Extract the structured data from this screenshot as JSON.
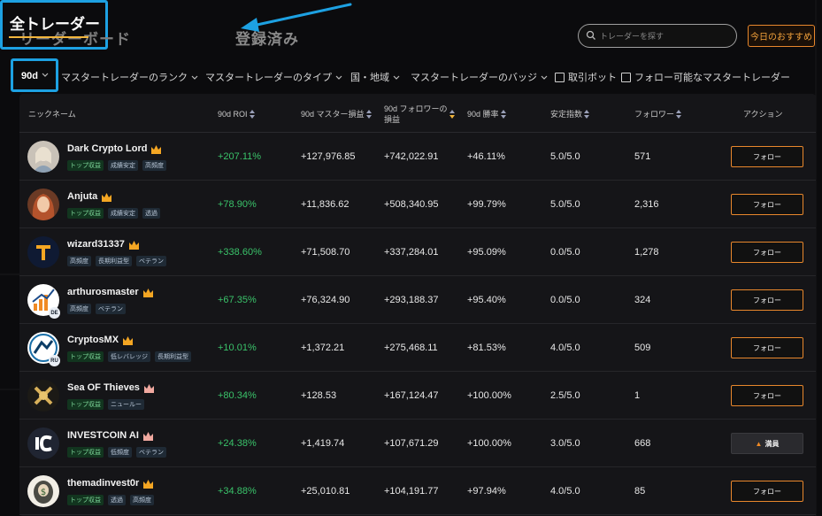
{
  "tabs": {
    "leaderboard": "リーダーボード",
    "all_traders": "全トレーダー",
    "registered": "登録済み"
  },
  "search": {
    "placeholder": "トレーダーを探す"
  },
  "today_recommend": "今日のおすすめ",
  "filters": {
    "period": "90d",
    "rank": "マスタートレーダーのランク",
    "type": "マスタートレーダーのタイプ",
    "region": "国・地域",
    "badge": "マスタートレーダーのバッジ",
    "trading_bot": "取引ボット",
    "followable": "フォロー可能なマスタートレーダー"
  },
  "table": {
    "headers": {
      "nickname": "ニックネーム",
      "roi": "90d ROI",
      "pnl": "90d マスター損益",
      "follower_pnl_1": "90d フォロワーの",
      "follower_pnl_2": "損益",
      "win_rate": "90d 勝率",
      "stability": "安定指数",
      "followers": "フォロワー",
      "action": "アクション"
    },
    "rows": [
      {
        "name": "Dark Crypto Lord",
        "tags": [
          "トップ収益",
          "成績安定",
          "高頻度"
        ],
        "roi": "+207.11%",
        "pnl": "+127,976.85",
        "follower_pnl": "+742,022.91",
        "win_rate": "+46.11%",
        "stability": "5.0/5.0",
        "followers": "571",
        "action": "フォロー"
      },
      {
        "name": "Anjuta",
        "tags": [
          "トップ収益",
          "成績安定",
          "透過"
        ],
        "roi": "+78.90%",
        "pnl": "+11,836.62",
        "follower_pnl": "+508,340.95",
        "win_rate": "+99.79%",
        "stability": "5.0/5.0",
        "followers": "2,316",
        "action": "フォロー"
      },
      {
        "name": "wizard31337",
        "tags": [
          "高頻度",
          "長期利益型",
          "ベテラン"
        ],
        "roi": "+338.60%",
        "pnl": "+71,508.70",
        "follower_pnl": "+337,284.01",
        "win_rate": "+95.09%",
        "stability": "0.0/5.0",
        "followers": "1,278",
        "action": "フォロー"
      },
      {
        "name": "arthurosmaster",
        "tags": [
          "高頻度",
          "ベテラン"
        ],
        "roi": "+67.35%",
        "pnl": "+76,324.90",
        "follower_pnl": "+293,188.37",
        "win_rate": "+95.40%",
        "stability": "0.0/5.0",
        "followers": "324",
        "action": "フォロー"
      },
      {
        "name": "CryptosMX",
        "tags": [
          "トップ収益",
          "低レバレッジ",
          "長期利益型"
        ],
        "roi": "+10.01%",
        "pnl": "+1,372.21",
        "follower_pnl": "+275,468.11",
        "win_rate": "+81.53%",
        "stability": "4.0/5.0",
        "followers": "509",
        "action": "フォロー"
      },
      {
        "name": "Sea OF Thieves",
        "tags": [
          "トップ収益",
          "ニュールー"
        ],
        "roi": "+80.34%",
        "pnl": "+128.53",
        "follower_pnl": "+167,124.47",
        "win_rate": "+100.00%",
        "stability": "2.5/5.0",
        "followers": "1",
        "action": "フォロー"
      },
      {
        "name": "INVESTCOIN AI",
        "tags": [
          "トップ収益",
          "低頻度",
          "ベテラン"
        ],
        "roi": "+24.38%",
        "pnl": "+1,419.74",
        "follower_pnl": "+107,671.29",
        "win_rate": "+100.00%",
        "stability": "3.0/5.0",
        "followers": "668",
        "action": "満員"
      },
      {
        "name": "themadinvest0r",
        "tags": [
          "トップ収益",
          "透過",
          "高頻度"
        ],
        "roi": "+34.88%",
        "pnl": "+25,010.81",
        "follower_pnl": "+104,191.77",
        "win_rate": "+97.94%",
        "stability": "4.0/5.0",
        "followers": "85",
        "action": "フォロー"
      }
    ]
  },
  "avatar_badges": {
    "arthurosmaster": "DE",
    "CryptosMX": "RU"
  },
  "colors": {
    "accent": "#f1b53d",
    "highlight": "#1da1e2",
    "positive": "#3ac36a",
    "button_border": "#e8872c"
  }
}
